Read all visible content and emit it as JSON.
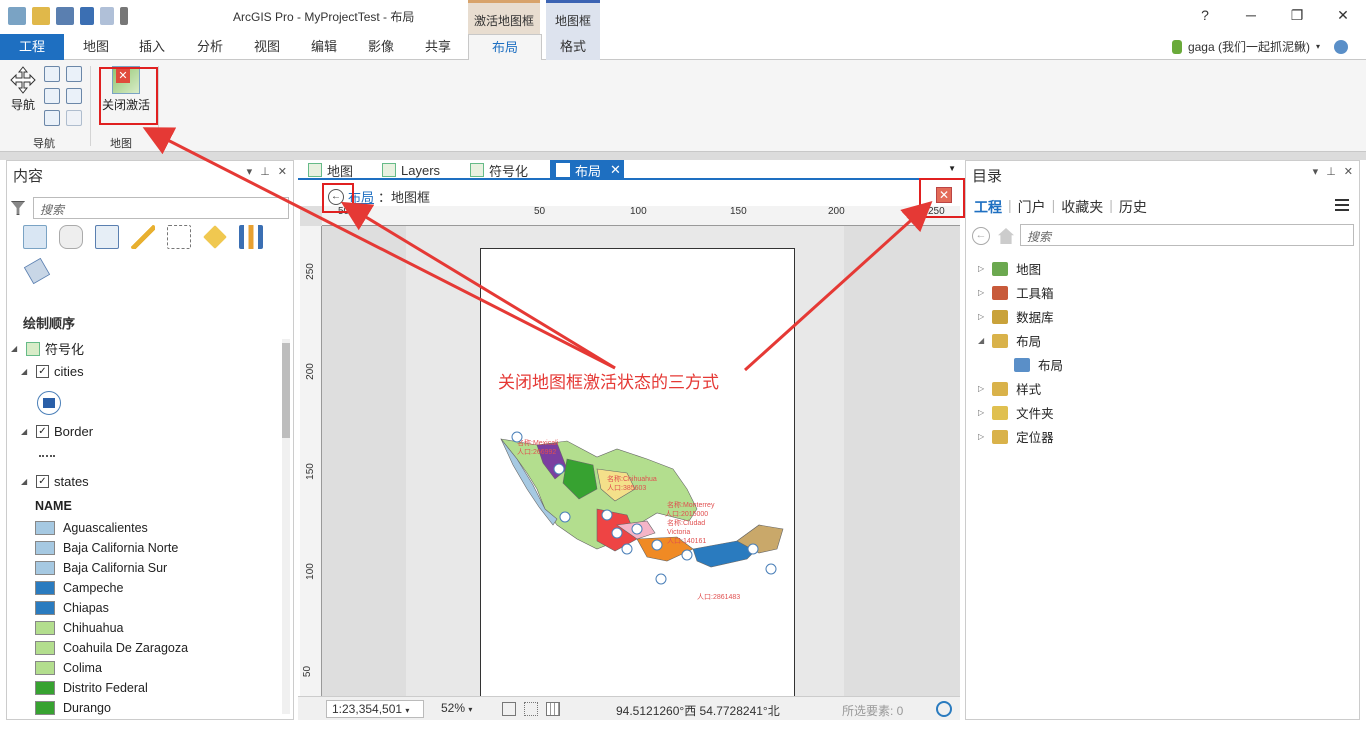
{
  "titlebar": {
    "app_title": "ArcGIS Pro - MyProjectTest - 布局",
    "context_tab_1": "激活地图框",
    "context_tab_2": "地图框",
    "help": "?",
    "minimize": "─",
    "restore": "❐",
    "close": "✕"
  },
  "ribbon_tabs": [
    "工程",
    "地图",
    "插入",
    "分析",
    "视图",
    "编辑",
    "影像",
    "共享",
    "布局",
    "格式"
  ],
  "user": {
    "name": "gaga (我们一起抓泥鳅)"
  },
  "ribbon": {
    "nav_label": "导航",
    "nav_group": "导航",
    "close_activation_label": "关闭激活",
    "map_group": "地图"
  },
  "contents": {
    "title": "内容",
    "search_placeholder": "搜索",
    "draw_order": "绘制顺序",
    "map_name": "符号化",
    "layers": [
      {
        "name": "cities",
        "checked": true
      },
      {
        "name": "Border",
        "checked": true
      },
      {
        "name": "states",
        "checked": true
      }
    ],
    "legend_field": "NAME",
    "legend_items": [
      {
        "name": "Aguascalientes",
        "color": "#a6c9e2"
      },
      {
        "name": "Baja California Norte",
        "color": "#a6c9e2"
      },
      {
        "name": "Baja California Sur",
        "color": "#a6c9e2"
      },
      {
        "name": "Campeche",
        "color": "#2a7bbf"
      },
      {
        "name": "Chiapas",
        "color": "#2a7bbf"
      },
      {
        "name": "Chihuahua",
        "color": "#b3de8e"
      },
      {
        "name": "Coahuila De Zaragoza",
        "color": "#b3de8e"
      },
      {
        "name": "Colima",
        "color": "#b3de8e"
      },
      {
        "name": "Distrito Federal",
        "color": "#37a231"
      },
      {
        "name": "Durango",
        "color": "#37a231"
      }
    ]
  },
  "view": {
    "tabs": [
      "地图",
      "Layers",
      "符号化",
      "布局"
    ],
    "breadcrumb_link": "布局",
    "breadcrumb_rest": "：地图框",
    "ruler_h": [
      "50",
      "50",
      "100",
      "150",
      "200",
      "250"
    ],
    "ruler_v": [
      "250",
      "200",
      "150",
      "100",
      "50"
    ],
    "scale": "1:23,354,501",
    "zoom": "52%",
    "coords": "94.5121260°西 54.7728241°北",
    "selected": "所选要素: 0"
  },
  "catalog": {
    "title": "目录",
    "tabs": [
      "工程",
      "门户",
      "收藏夹",
      "历史"
    ],
    "search_placeholder": "搜索",
    "items": [
      {
        "label": "地图",
        "color": "#6ba84f"
      },
      {
        "label": "工具箱",
        "color": "#c85a3a"
      },
      {
        "label": "数据库",
        "color": "#c9a23a"
      },
      {
        "label": "布局",
        "color": "#d9b24a"
      },
      {
        "label": "布局",
        "color": "#5a8fc8"
      },
      {
        "label": "样式",
        "color": "#d9b24a"
      },
      {
        "label": "文件夹",
        "color": "#e0c050"
      },
      {
        "label": "定位器",
        "color": "#d9b24a"
      }
    ]
  },
  "annotation": {
    "text": "关闭地图框激活状态的三方式",
    "color": "#e53935"
  },
  "map_labels": [
    "名称:Mexicali",
    "人口:266992",
    "名称:Chihuahua",
    "人口:385603",
    "名称:Monterrey",
    "人口:2015000",
    "名称:Ciudad",
    "Victoria",
    "人口:140161",
    "人口:2861483"
  ]
}
